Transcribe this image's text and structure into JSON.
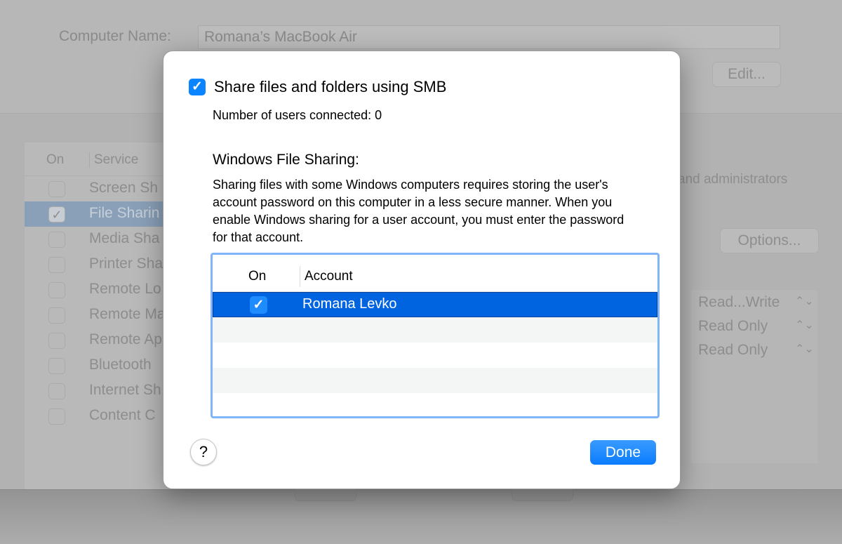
{
  "background": {
    "computer_name_label": "Computer Name:",
    "computer_name_value": "Romana’s MacBook Air",
    "edit_button": "Edit...",
    "services_header": {
      "on": "On",
      "service": "Service"
    },
    "services": [
      {
        "name": "Screen Sh",
        "checked": false
      },
      {
        "name": "File Sharin",
        "checked": true,
        "selected": true
      },
      {
        "name": "Media Sha",
        "checked": false
      },
      {
        "name": "Printer Sha",
        "checked": false
      },
      {
        "name": "Remote Lo",
        "checked": false
      },
      {
        "name": "Remote Ma",
        "checked": false
      },
      {
        "name": "Remote Ap",
        "checked": false
      },
      {
        "name": "Bluetooth",
        "checked": false
      },
      {
        "name": "Internet Sh",
        "checked": false
      },
      {
        "name": "Content C",
        "checked": false
      }
    ],
    "admins_text": "and administrators",
    "options_button": "Options...",
    "permissions": [
      "Read...Write",
      "Read Only",
      "Read Only"
    ]
  },
  "dialog": {
    "smb_checkbox": {
      "label": "Share files and folders using SMB",
      "checked": true
    },
    "users_connected": "Number of users connected: 0",
    "windows_heading": "Windows File Sharing:",
    "description": "Sharing files with some Windows computers requires storing the user's account password on this computer in a less secure manner. When you enable Windows sharing for a user account, you must enter the password for that account.",
    "table": {
      "header_on": "On",
      "header_account": "Account",
      "rows": [
        {
          "account": "Romana Levko",
          "checked": true
        }
      ]
    },
    "help_label": "?",
    "done_label": "Done"
  },
  "colors": {
    "accent": "#0a84ff",
    "selection": "#0064e1",
    "table_focus": "#80b5f7"
  }
}
